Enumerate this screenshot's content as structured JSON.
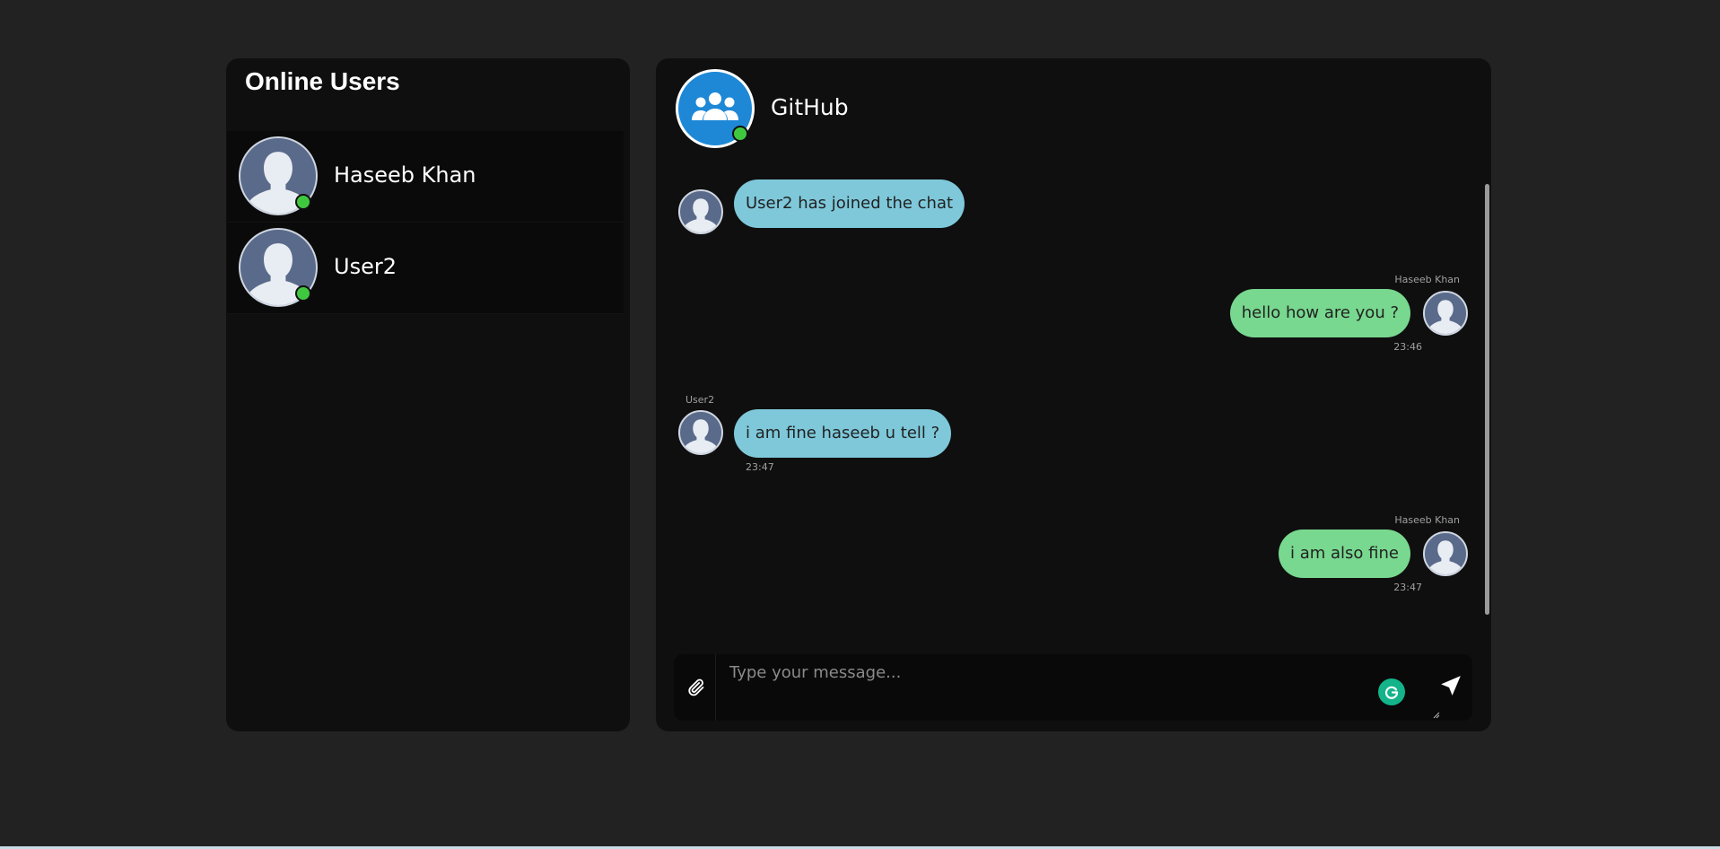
{
  "sidebar": {
    "title": "Online Users",
    "users": [
      {
        "name": "Haseeb Khan",
        "status": "online"
      },
      {
        "name": "User2",
        "status": "online"
      }
    ]
  },
  "chat": {
    "title": "GitHub",
    "messages": [
      {
        "direction": "incoming",
        "sender": "",
        "text": "User2 has joined the chat",
        "time": ""
      },
      {
        "direction": "outgoing",
        "sender": "Haseeb Khan",
        "text": "hello how are you ?",
        "time": "23:46"
      },
      {
        "direction": "incoming",
        "sender": "User2",
        "text": "i am fine haseeb u tell ?",
        "time": "23:47"
      },
      {
        "direction": "outgoing",
        "sender": "Haseeb Khan",
        "text": "i am also fine",
        "time": "23:47"
      }
    ]
  },
  "composer": {
    "placeholder": "Type your message...",
    "value": ""
  },
  "icons": {
    "attach": "paperclip-icon",
    "send": "send-icon",
    "grammarly": "grammarly-icon",
    "group": "group-icon",
    "avatar": "user-avatar-icon"
  },
  "colors": {
    "background": "#222222",
    "panel": "#0f0f0f",
    "incoming_bubble": "#7ec8da",
    "outgoing_bubble": "#78d88f",
    "online": "#3fc83f",
    "group_avatar": "#1e88d6"
  }
}
